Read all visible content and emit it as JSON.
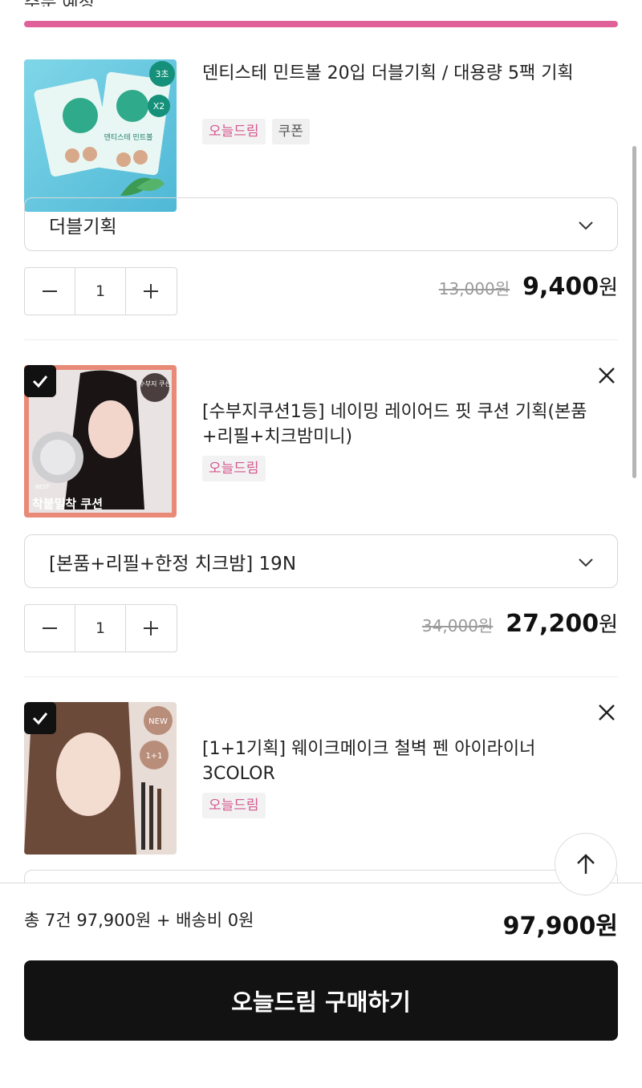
{
  "header": {
    "cut_text": "주문 예정"
  },
  "items": [
    {
      "title": "덴티스테 민트볼 20입 더블기획 / 대용량 5팩 기획",
      "tags": [
        "오늘드림",
        "쿠폰"
      ],
      "option": "더블기획",
      "quantity": "1",
      "original_price": "13,000원",
      "final_price": "9,400",
      "won": "원",
      "thumb_text": [
        "3초",
        "X2",
        "덴티스테 민트볼"
      ],
      "checked": false
    },
    {
      "title": "[수부지쿠션1등] 네이밍 레이어드 핏 쿠션 기획(본품+리필+치크밤미니)",
      "tags": [
        "오늘드림"
      ],
      "option": "[본품+리필+한정 치크밤] 19N",
      "quantity": "1",
      "original_price": "34,000원",
      "final_price": "27,200",
      "won": "원",
      "thumb_text": [
        "수부지 쿠션",
        "BEST",
        "착붙밀착 쿠션"
      ],
      "checked": true
    },
    {
      "title": "[1+1기획] 웨이크메이크 철벽 펜 아이라이너 3COLOR",
      "tags": [
        "오늘드림"
      ],
      "thumb_text": [
        "NEW",
        "1+1"
      ],
      "checked": true
    }
  ],
  "footer": {
    "summary": "총 7건 97,900원 + 배송비 0원",
    "total": "97,900원",
    "buy_label": "오늘드림 구매하기"
  },
  "colors": {
    "accent": "#e0609a",
    "tag_pink": "#d4568f",
    "button_dark": "#121212"
  }
}
